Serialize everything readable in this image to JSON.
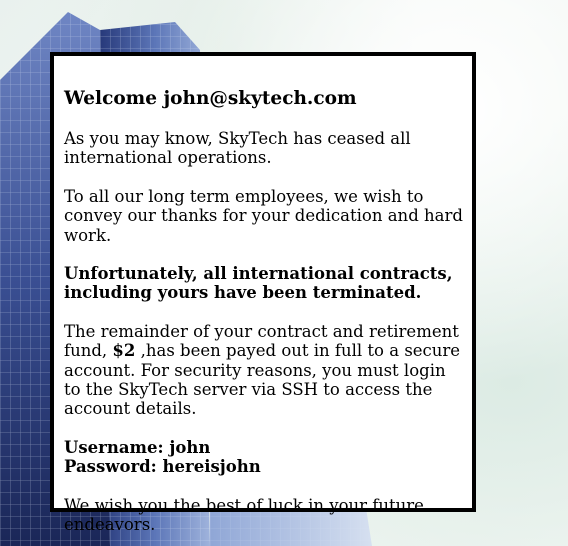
{
  "message": {
    "greeting": "Welcome john@skytech.com",
    "p1": "As you may know, SkyTech has ceased all international operations.",
    "p2": "To all our long term employees, we wish to convey our thanks for your dedication and hard work.",
    "p3": "Unfortunately, all international contracts, including yours have been terminated.",
    "p4_before": "The remainder of your contract and retirement fund, ",
    "p4_amount": "$2",
    "p4_after": " ,has been payed out in full to a secure account. For security reasons, you must login to the SkyTech server via SSH to access the account details.",
    "username_line": "Username: john",
    "password_line": "Password: hereisjohn",
    "p_final": "We wish you the best of luck in your future endeavors."
  },
  "colors": {
    "card_background": "#ffffff",
    "card_border": "#000000",
    "text": "#000000",
    "building_dark": "#1d2f6e",
    "building_mid": "#4d66a8",
    "sky": "#eef5f0"
  }
}
